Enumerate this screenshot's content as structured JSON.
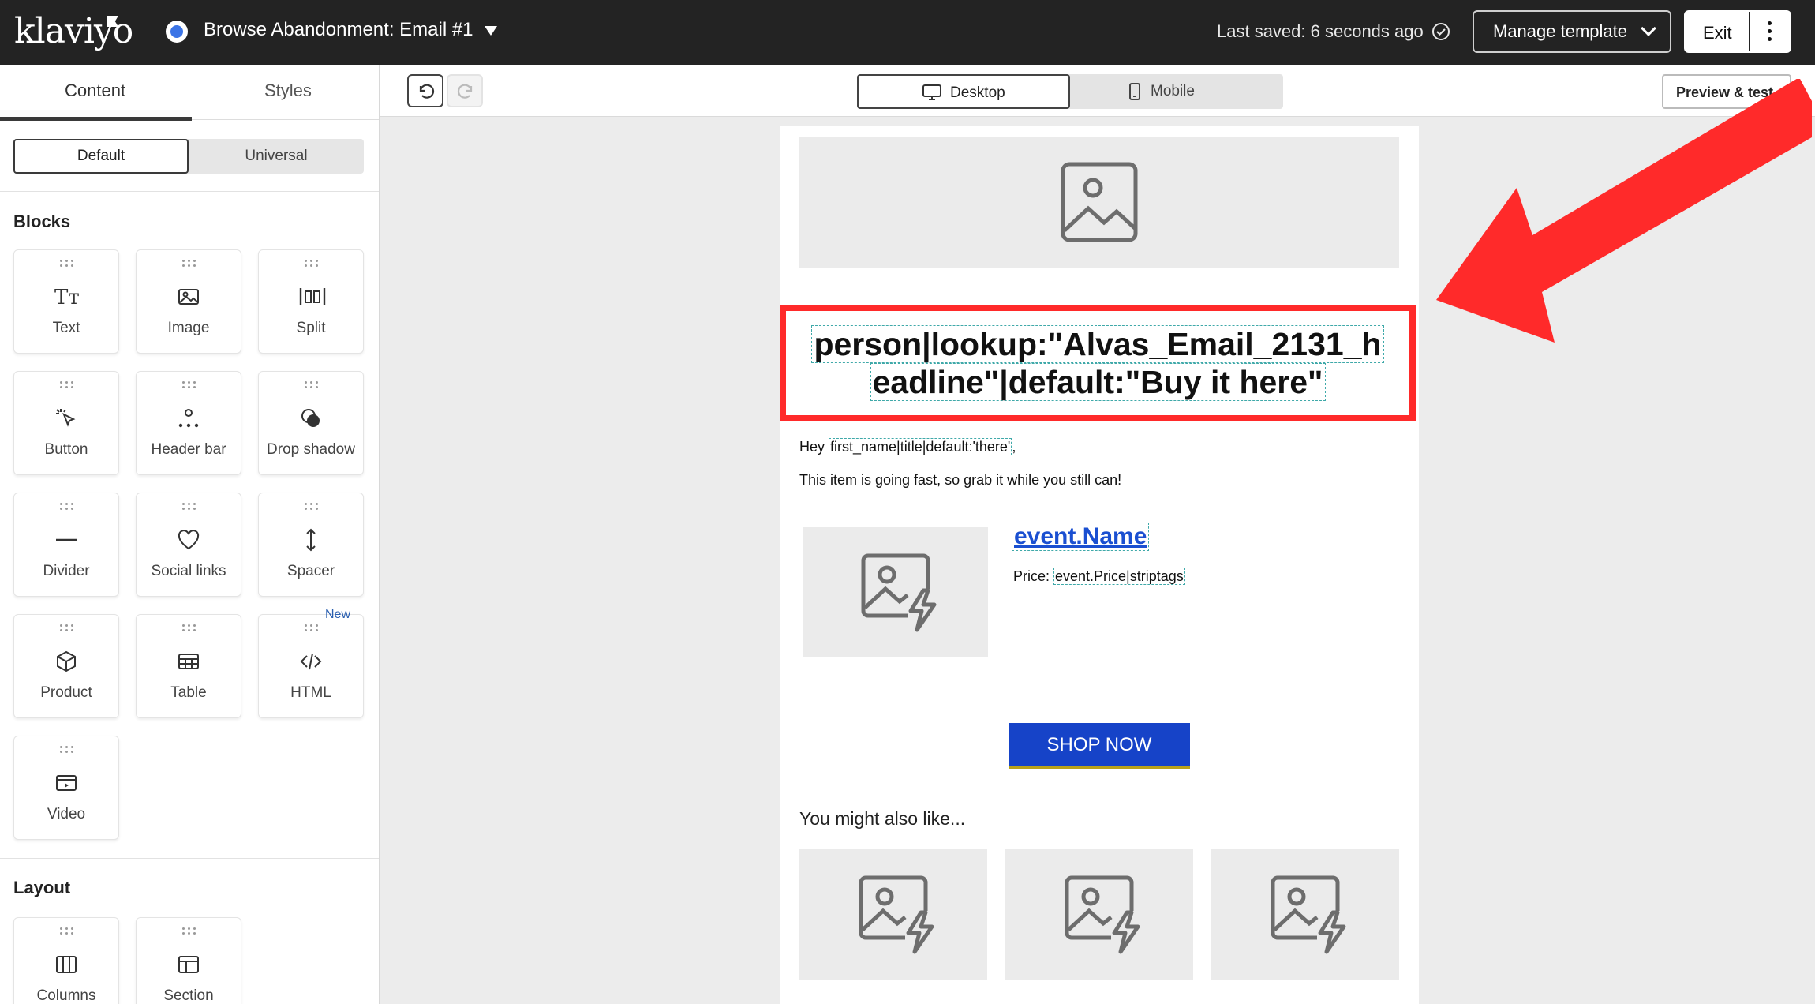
{
  "header": {
    "logo": "klaviyo",
    "flow_title": "Browse Abandonment: Email #1",
    "last_saved": "Last saved: 6 seconds ago",
    "manage_template": "Manage template",
    "exit": "Exit"
  },
  "left_panel": {
    "tabs": [
      "Content",
      "Styles"
    ],
    "active_tab": "Content",
    "segment": [
      "Default",
      "Universal"
    ],
    "blocks_heading": "Blocks",
    "blocks": [
      {
        "label": "Text",
        "icon": "text-icon"
      },
      {
        "label": "Image",
        "icon": "image-icon"
      },
      {
        "label": "Split",
        "icon": "split-icon"
      },
      {
        "label": "Button",
        "icon": "button-cursor-icon"
      },
      {
        "label": "Header bar",
        "icon": "header-bar-icon"
      },
      {
        "label": "Drop shadow",
        "icon": "drop-shadow-icon"
      },
      {
        "label": "Divider",
        "icon": "divider-icon"
      },
      {
        "label": "Social links",
        "icon": "heart-icon"
      },
      {
        "label": "Spacer",
        "icon": "spacer-icon"
      },
      {
        "label": "Product",
        "icon": "product-box-icon"
      },
      {
        "label": "Table",
        "icon": "table-icon"
      },
      {
        "label": "HTML",
        "icon": "code-icon"
      },
      {
        "label": "Video",
        "icon": "video-icon"
      }
    ],
    "new_badge": "New",
    "layout_heading": "Layout",
    "layout_blocks": [
      {
        "label": "Columns",
        "icon": "columns-icon"
      },
      {
        "label": "Section",
        "icon": "section-icon"
      }
    ]
  },
  "toolbar": {
    "desktop": "Desktop",
    "mobile": "Mobile",
    "preview": "Preview & test"
  },
  "email": {
    "headline_line1": "person|lookup:\"Alvas_Email_2131_h",
    "headline_line2": "eadline\"|default:\"Buy it here\"",
    "hey_prefix": "Hey ",
    "hey_tag": "first_name|title|default:'there'",
    "hey_suffix": ",",
    "going_fast": "This item is going fast, so grab it while you still can!",
    "product_name": "event.Name",
    "price_label": "Price: ",
    "price_tag": "event.Price|striptags",
    "shop_button": "SHOP NOW",
    "might_like": "You might also like..."
  },
  "colors": {
    "topbar": "#232323",
    "highlight_red": "#ff2a2a",
    "shop_button": "#1643c8",
    "link_blue": "#1a4fd1"
  }
}
